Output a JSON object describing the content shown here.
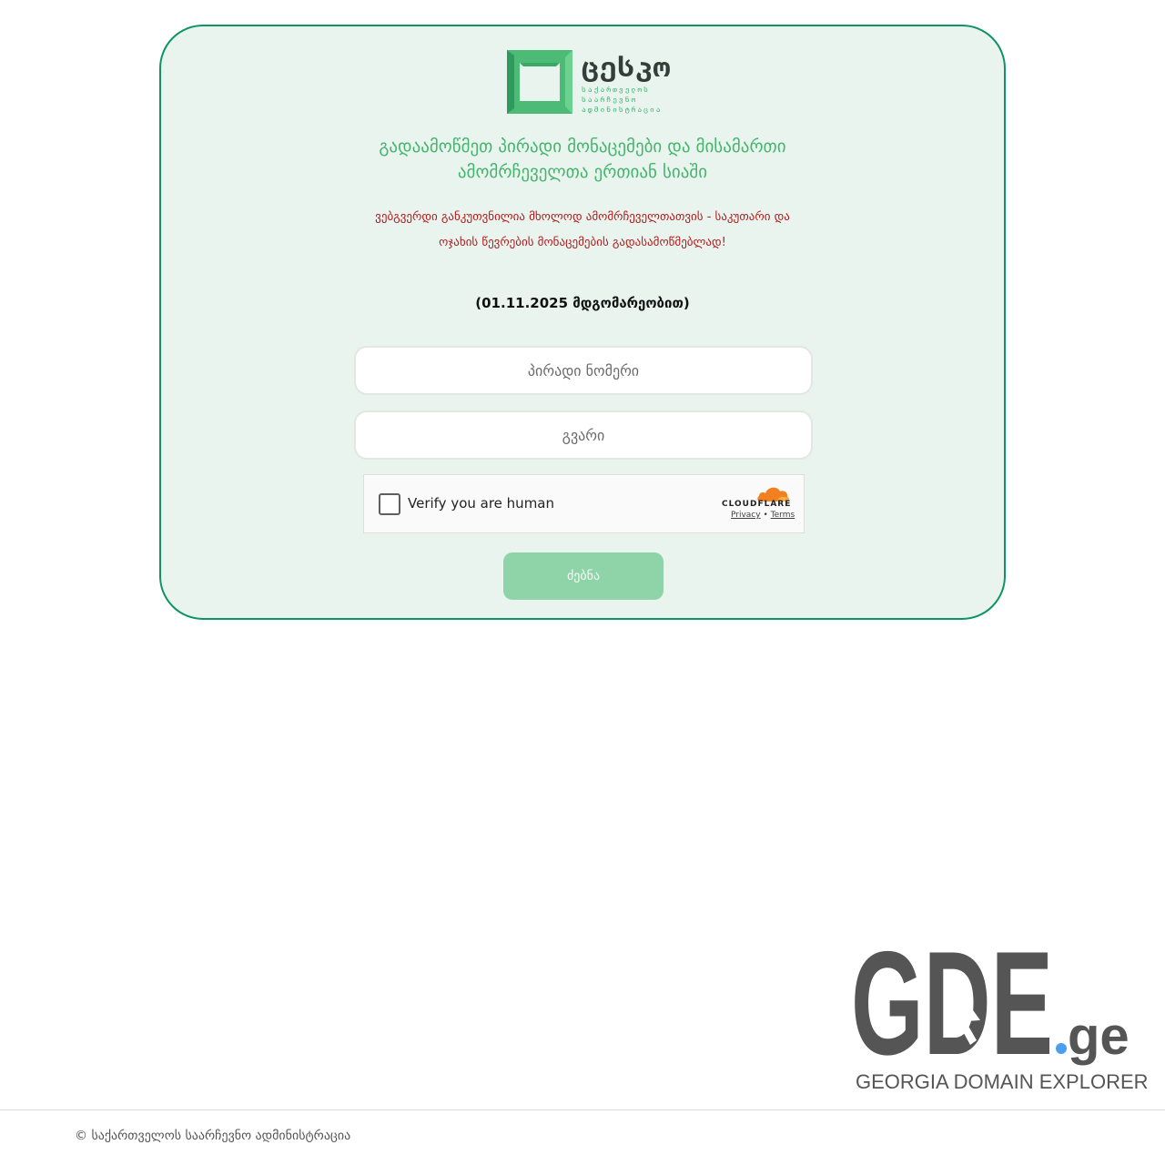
{
  "logo": {
    "word": "ცესკო",
    "sub_lines": [
      "საქართველოს",
      "საარჩევნო",
      "ადმინისტრაცია"
    ],
    "brand_color": "#39b26e"
  },
  "title_lines": [
    "გადაამოწმეთ პირადი მონაცემები და მისამართი",
    "ამომრჩეველთა ერთიან სიაში"
  ],
  "warning_lines": [
    "ვებგვერდი განკუთვნილია მხოლოდ ამომრჩეველთათვის - საკუთარი და",
    "ოჯახის წევრების მონაცემების გადასამოწმებლად!"
  ],
  "status_date": "(01.11.2025 მდგომარეობით)",
  "form": {
    "personal_id_placeholder": "პირადი ნომერი",
    "personal_id_value": "",
    "surname_placeholder": "გვარი",
    "surname_value": "",
    "submit_label": "ძებნა"
  },
  "captcha": {
    "label": "Verify you are human",
    "brand": "CLOUDFLARE",
    "privacy": "Privacy",
    "separator": "•",
    "terms": "Terms",
    "icon": "cloudflare-cloud-icon"
  },
  "gde": {
    "letters": "GDE",
    "dot": ".",
    "suffix": "ge",
    "tagline": "GEORGIA DOMAIN EXPLORER",
    "dot_color": "#4a9ff0"
  },
  "footer": {
    "copyright": "© საქართველოს საარჩევნო ადმინისტრაცია"
  },
  "colors": {
    "card_border": "#0e9466",
    "card_bg": "#e9f4ef",
    "title": "#45b56d",
    "warning": "#b01c1c",
    "submit_bg": "#8fd4a8"
  }
}
